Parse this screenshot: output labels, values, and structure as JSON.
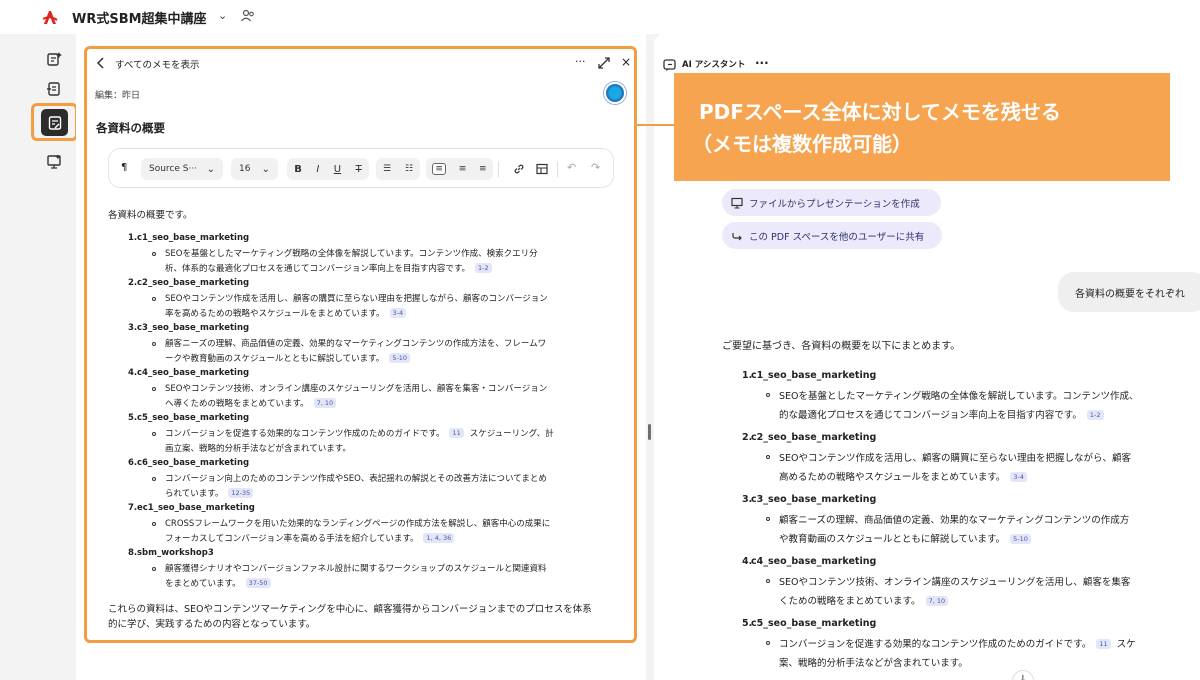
{
  "app": {
    "title": "WR式SBM超集中講座"
  },
  "note": {
    "back_label": "すべてのメモを表示",
    "edited": "編集：昨日",
    "heading": "各資料の概要",
    "toolbar": {
      "font": "Source S···",
      "size": "16"
    },
    "intro": "各資料の概要です。",
    "items": [
      {
        "num": "1.",
        "title": "c1_seo_base_marketing",
        "lines": [
          "SEOを基盤としたマーケティング戦略の全体像を解説しています。コンテンツ作成、検索クエリ分",
          "析、体系的な最適化プロセスを通じてコンバージョン率向上を目指す内容です。"
        ],
        "badge": "1-2"
      },
      {
        "num": "2.",
        "title": "c2_seo_base_marketing",
        "lines": [
          "SEOやコンテンツ作成を活用し、顧客の購買に至らない理由を把握しながら、顧客のコンバージョン",
          "率を高めるための戦略やスケジュールをまとめています。"
        ],
        "badge": "3-4"
      },
      {
        "num": "3.",
        "title": "c3_seo_base_marketing",
        "lines": [
          "顧客ニーズの理解、商品価値の定義、効果的なマーケティングコンテンツの作成方法を、フレームワ",
          "ークや教育動画のスケジュールとともに解説しています。"
        ],
        "badge": "5-10"
      },
      {
        "num": "4.",
        "title": "c4_seo_base_marketing",
        "lines": [
          "SEOやコンテンツ技術、オンライン講座のスケジューリングを活用し、顧客を集客・コンバージョン",
          "へ導くための戦略をまとめています。"
        ],
        "badge": "7, 10"
      },
      {
        "num": "5.",
        "title": "c5_seo_base_marketing",
        "lines": [
          "コンバージョンを促進する効果的なコンテンツ作成のためのガイドです。",
          "画立案、戦略的分析手法などが含まれています。"
        ],
        "badge": "11",
        "line1_tail": "スケジューリング、計",
        "badge_inline_first": true
      },
      {
        "num": "6.",
        "title": "c6_seo_base_marketing",
        "lines": [
          "コンバージョン向上のためのコンテンツ作成やSEO、表記揺れの解説とその改善方法についてまとめ",
          "られています。"
        ],
        "badge": "12-35"
      },
      {
        "num": "7.",
        "title": "ec1_seo_base_marketing",
        "lines": [
          "CROSSフレームワークを用いた効果的なランディングページの作成方法を解説し、顧客中心の成果に",
          "フォーカスしてコンバージョン率を高める手法を紹介しています。"
        ],
        "badge": "1, 4, 36"
      },
      {
        "num": "8.",
        "title": "sbm_workshop3",
        "lines": [
          "顧客獲得シナリオやコンバージョンファネル設計に関するワークショップのスケジュールと関連資料",
          "をまとめています。"
        ],
        "badge": "37-50"
      }
    ],
    "summary": [
      "これらの資料は、SEOやコンテンツマーケティングを中心に、顧客獲得からコンバージョンまでのプロセスを体系",
      "的に学び、実践するための内容となっています。"
    ]
  },
  "assistant": {
    "title": "AI アシスタント",
    "callout": [
      "PDFスペース全体に対してメモを残せる",
      "（メモは複数作成可能）"
    ],
    "chips": [
      "ファイルからプレゼンテーションを作成",
      "この PDF スペースを他のユーザーに共有"
    ],
    "user_message": "各資料の概要をそれぞれ",
    "reply_intro": "ご要望に基づき、各資料の概要を以下にまとめます。",
    "items": [
      {
        "num": "1.",
        "title": "c1_seo_base_marketing",
        "lines": [
          "SEOを基盤としたマーケティング戦略の全体像を解説しています。コンテンツ作成、",
          "的な最適化プロセスを通じてコンバージョン率向上を目指す内容です。"
        ],
        "badge": "1-2"
      },
      {
        "num": "2.",
        "title": "c2_seo_base_marketing",
        "lines": [
          "SEOやコンテンツ作成を活用し、顧客の購買に至らない理由を把握しながら、顧客",
          "高めるための戦略やスケジュールをまとめています。"
        ],
        "badge": "3-4"
      },
      {
        "num": "3.",
        "title": "c3_seo_base_marketing",
        "lines": [
          "顧客ニーズの理解、商品価値の定義、効果的なマーケティングコンテンツの作成方",
          "や教育動画のスケジュールとともに解説しています。"
        ],
        "badge": "5-10"
      },
      {
        "num": "4.",
        "title": "c4_seo_base_marketing",
        "lines": [
          "SEOやコンテンツ技術、オンライン講座のスケジューリングを活用し、顧客を集客",
          "くための戦略をまとめています。"
        ],
        "badge": "7, 10"
      },
      {
        "num": "5.",
        "title": "c5_seo_base_marketing",
        "lines": [
          "コンバージョンを促進する効果的なコンテンツ作成のためのガイドです。",
          "案、戦略的分析手法などが含まれています。"
        ],
        "badge": "11",
        "line1_tail": "スケ",
        "badge_inline_first": true
      }
    ]
  },
  "colors": {
    "accent": "#f29d42",
    "callout_bg": "#f6a450",
    "chip_bg": "#eceafa",
    "badge_bg": "#e3e6f7",
    "pdf_red": "#e1251b"
  },
  "icons": [
    "pdf-logo-icon",
    "chevron-down-icon",
    "people-icon",
    "rail-ai-icon",
    "rail-doc-icon",
    "rail-notes-icon",
    "rail-presentation-icon",
    "back-chevron-icon",
    "more-icon",
    "expand-icon",
    "close-icon",
    "avatar",
    "paragraph-icon",
    "bold-icon",
    "italic-icon",
    "underline-icon",
    "strikethrough-icon",
    "bullet-list-icon",
    "numbered-list-icon",
    "align-left-icon",
    "align-center-icon",
    "align-right-icon",
    "link-icon",
    "table-icon",
    "undo-icon",
    "redo-icon",
    "assistant-icon",
    "presentation-icon",
    "share-icon"
  ]
}
